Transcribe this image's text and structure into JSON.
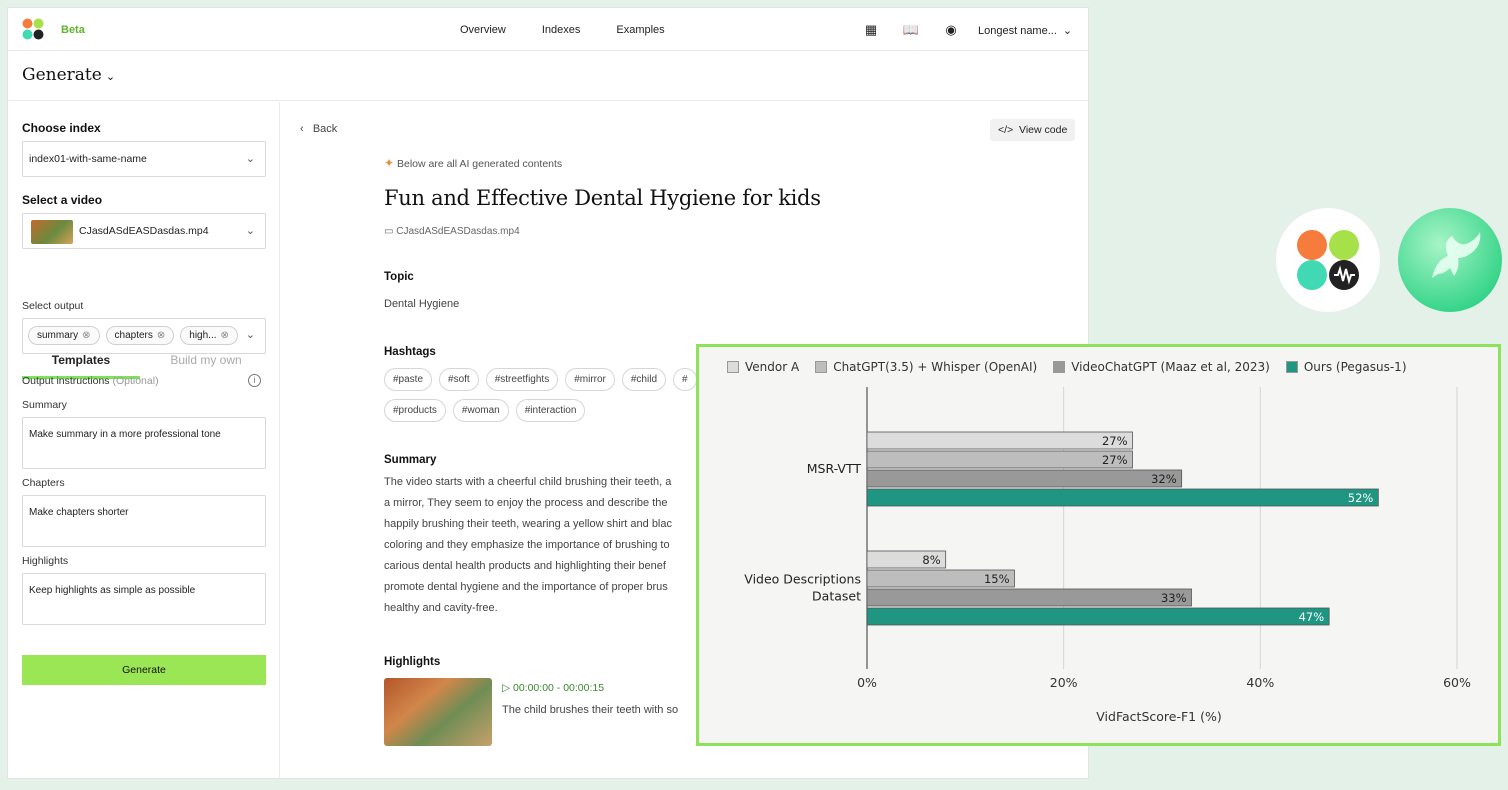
{
  "topbar": {
    "beta": "Beta",
    "nav": [
      "Overview",
      "Indexes",
      "Examples"
    ],
    "user": "Longest name..."
  },
  "generate_title": "Generate",
  "sidebar": {
    "choose_index_label": "Choose index",
    "index_value": "index01-with-same-name",
    "select_video_label": "Select a video",
    "video_value": "CJasdASdEASDasdas.mp4",
    "tab_templates": "Templates",
    "tab_build": "Build my own",
    "select_output_label": "Select output",
    "chips": [
      "summary",
      "chapters",
      "high..."
    ],
    "output_instructions_label": "Output instructions",
    "optional": "(Optional)",
    "summary_label": "Summary",
    "summary_text": "Make summary in a more professional tone",
    "chapters_label": "Chapters",
    "chapters_text": "Make chapters shorter",
    "highlights_label": "Highlights",
    "highlights_text": "Keep highlights as simple as possible",
    "generate_button": "Generate"
  },
  "main": {
    "back": "Back",
    "view_code": "View code",
    "ai_note": "Below are all AI generated contents",
    "title": "Fun and Effective Dental Hygiene for kids",
    "filename": "CJasdASdEASDasdas.mp4",
    "topic_label": "Topic",
    "topic": "Dental Hygiene",
    "hashtags_label": "Hashtags",
    "hashtags": [
      "#paste",
      "#soft",
      "#streetfights",
      "#mirror",
      "#child",
      "#",
      "#products",
      "#woman",
      "#interaction"
    ],
    "summary_label": "Summary",
    "summary_lines": [
      "The video starts with a cheerful child brushing their teeth, a",
      "a mirror, They seem to enjoy the process and describe the",
      "happily brushing their teeth, wearing a yellow shirt and blac",
      "coloring and they emphasize the importance of brushing to",
      "carious dental health products and highlighting their benef",
      "promote dental hygiene and the importance of proper brus",
      "healthy and cavity-free."
    ],
    "highlights_label": "Highlights",
    "highlight_time": "00:00:00 - 00:00:15",
    "highlight_text": "The child brushes their teeth with so"
  },
  "chart_data": {
    "type": "bar",
    "orientation": "horizontal",
    "categories": [
      "MSR-VTT",
      "Video Descriptions Dataset"
    ],
    "category_lines": [
      [
        "MSR-VTT"
      ],
      [
        "Video Descriptions",
        "Dataset"
      ]
    ],
    "series": [
      {
        "name": "Vendor A",
        "values": [
          27,
          8
        ],
        "color": "#dcdcdc"
      },
      {
        "name": "ChatGPT(3.5) + Whisper (OpenAI)",
        "values": [
          27,
          15
        ],
        "color": "#bdbdbd"
      },
      {
        "name": "VideoChatGPT (Maaz et al, 2023)",
        "values": [
          32,
          33
        ],
        "color": "#999999"
      },
      {
        "name": "Ours (Pegasus-1)",
        "values": [
          52,
          47
        ],
        "color": "#1e9682"
      }
    ],
    "value_suffix": "%",
    "xlabel": "VidFactScore-F1 (%)",
    "xlim": [
      0,
      60
    ],
    "xticks": [
      "0%",
      "20%",
      "40%",
      "60%"
    ],
    "grid": true,
    "legend": "top"
  }
}
